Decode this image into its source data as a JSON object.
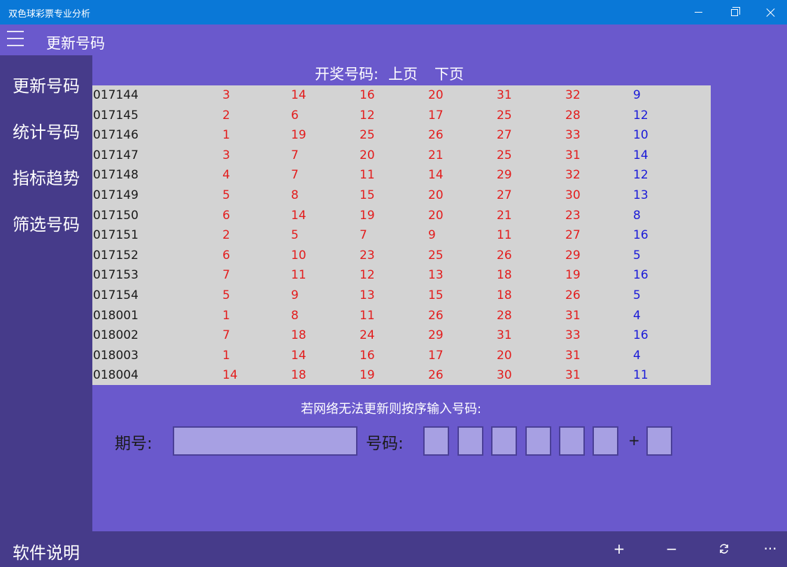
{
  "window": {
    "title": "双色球彩票专业分析"
  },
  "header": {
    "title": "更新号码"
  },
  "sidebar": {
    "items": [
      {
        "label": "更新号码"
      },
      {
        "label": "统计号码"
      },
      {
        "label": "指标趋势"
      },
      {
        "label": "筛选号码"
      }
    ]
  },
  "results": {
    "heading": "开奖号码:",
    "prev_label": "上页",
    "next_label": "下页",
    "rows": [
      {
        "issue": "017144",
        "red": [
          "3",
          "14",
          "16",
          "20",
          "31",
          "32"
        ],
        "blue": "9"
      },
      {
        "issue": "017145",
        "red": [
          "2",
          "6",
          "12",
          "17",
          "25",
          "28"
        ],
        "blue": "12"
      },
      {
        "issue": "017146",
        "red": [
          "1",
          "19",
          "25",
          "26",
          "27",
          "33"
        ],
        "blue": "10"
      },
      {
        "issue": "017147",
        "red": [
          "3",
          "7",
          "20",
          "21",
          "25",
          "31"
        ],
        "blue": "14"
      },
      {
        "issue": "017148",
        "red": [
          "4",
          "7",
          "11",
          "14",
          "29",
          "32"
        ],
        "blue": "12"
      },
      {
        "issue": "017149",
        "red": [
          "5",
          "8",
          "15",
          "20",
          "27",
          "30"
        ],
        "blue": "13"
      },
      {
        "issue": "017150",
        "red": [
          "6",
          "14",
          "19",
          "20",
          "21",
          "23"
        ],
        "blue": "8"
      },
      {
        "issue": "017151",
        "red": [
          "2",
          "5",
          "7",
          "9",
          "11",
          "27"
        ],
        "blue": "16"
      },
      {
        "issue": "017152",
        "red": [
          "6",
          "10",
          "23",
          "25",
          "26",
          "29"
        ],
        "blue": "5"
      },
      {
        "issue": "017153",
        "red": [
          "7",
          "11",
          "12",
          "13",
          "18",
          "19"
        ],
        "blue": "16"
      },
      {
        "issue": "017154",
        "red": [
          "5",
          "9",
          "13",
          "15",
          "18",
          "26"
        ],
        "blue": "5"
      },
      {
        "issue": "018001",
        "red": [
          "1",
          "8",
          "11",
          "26",
          "28",
          "31"
        ],
        "blue": "4"
      },
      {
        "issue": "018002",
        "red": [
          "7",
          "18",
          "24",
          "29",
          "31",
          "33"
        ],
        "blue": "16"
      },
      {
        "issue": "018003",
        "red": [
          "1",
          "14",
          "16",
          "17",
          "20",
          "31"
        ],
        "blue": "4"
      },
      {
        "issue": "018004",
        "red": [
          "14",
          "18",
          "19",
          "26",
          "30",
          "31"
        ],
        "blue": "11"
      }
    ]
  },
  "manual_entry": {
    "hint": "若网络无法更新则按序输入号码:",
    "period_label": "期号:",
    "period_value": "",
    "number_label": "号码:",
    "plus": "+",
    "red_values": [
      "",
      "",
      "",
      "",
      "",
      ""
    ],
    "blue_value": ""
  },
  "bottom": {
    "about_label": "软件说明",
    "add_icon": "plus-icon",
    "remove_icon": "minus-icon",
    "refresh_icon": "refresh-icon",
    "more_icon": "more-icon",
    "add_glyph": "+",
    "remove_glyph": "−",
    "more_glyph": "···"
  },
  "colors": {
    "titlebar": "#0a78d7",
    "background": "#6a59cc",
    "sidebar": "#463b8a",
    "table_bg": "#d3d3d3",
    "red_ball": "#e31c1c",
    "blue_ball": "#1a1ad8"
  }
}
